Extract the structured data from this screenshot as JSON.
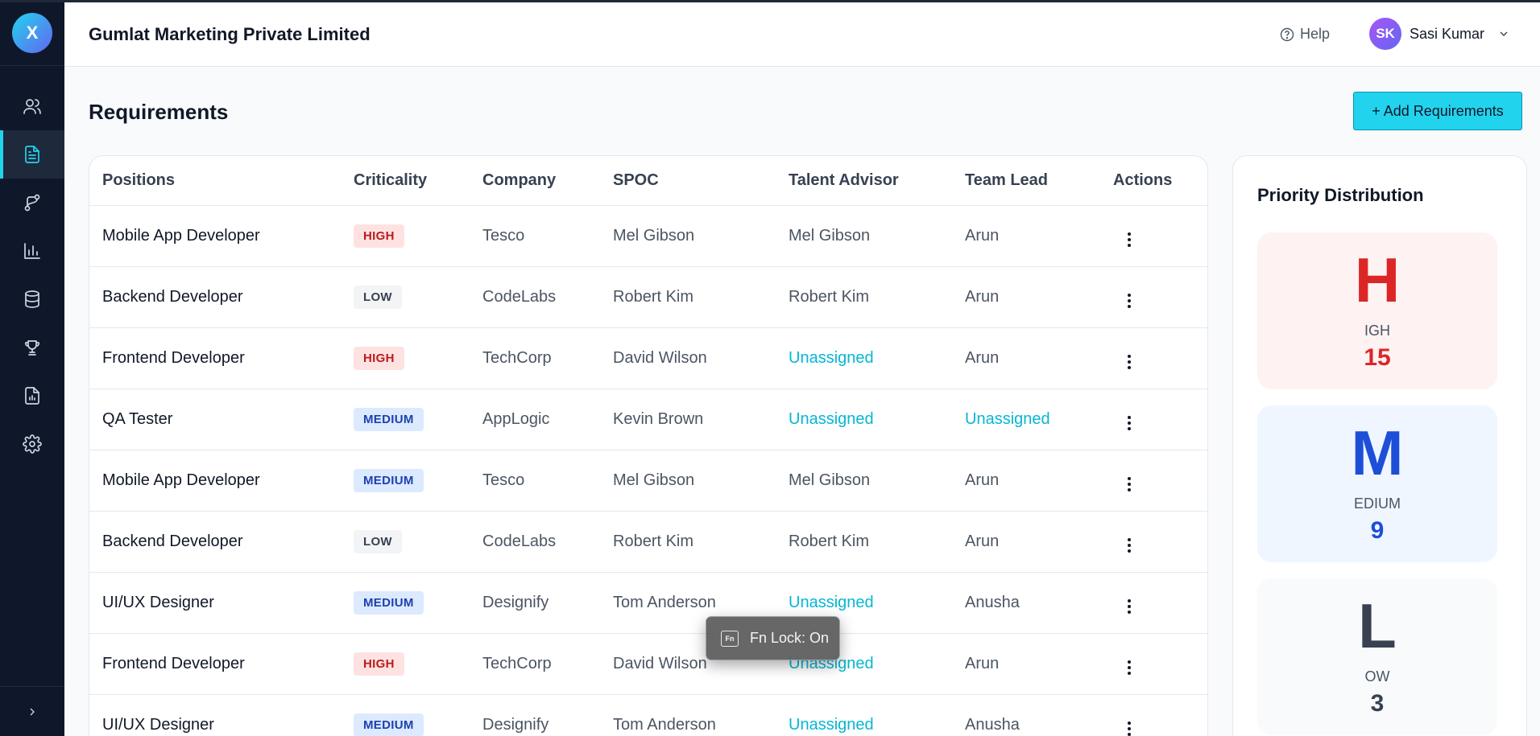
{
  "app": {
    "logo_letter": "X",
    "company_name": "Gumlat Marketing Private Limited"
  },
  "header": {
    "help_label": "Help",
    "user": {
      "initials": "SK",
      "name": "Sasi Kumar"
    }
  },
  "sidebar": {
    "items": [
      {
        "name": "users",
        "icon": "users-icon",
        "active": false
      },
      {
        "name": "requirements",
        "icon": "document-icon",
        "active": true
      },
      {
        "name": "pipeline",
        "icon": "git-branch-icon",
        "active": false
      },
      {
        "name": "analytics",
        "icon": "bar-chart-icon",
        "active": false
      },
      {
        "name": "database",
        "icon": "database-icon",
        "active": false
      },
      {
        "name": "achievements",
        "icon": "trophy-icon",
        "active": false
      },
      {
        "name": "reports",
        "icon": "report-icon",
        "active": false
      },
      {
        "name": "settings",
        "icon": "gear-icon",
        "active": false
      }
    ],
    "expand_icon": "chevron-right-icon"
  },
  "page": {
    "title": "Requirements",
    "add_button_label": "+ Add Requirements"
  },
  "table": {
    "columns": [
      "Positions",
      "Criticality",
      "Company",
      "SPOC",
      "Talent Advisor",
      "Team Lead",
      "Actions"
    ],
    "rows": [
      {
        "position": "Mobile App Developer",
        "criticality": "HIGH",
        "company": "Tesco",
        "spoc": "Mel Gibson",
        "talent_advisor": "Mel Gibson",
        "team_lead": "Arun"
      },
      {
        "position": "Backend Developer",
        "criticality": "LOW",
        "company": "CodeLabs",
        "spoc": "Robert Kim",
        "talent_advisor": "Robert Kim",
        "team_lead": "Arun"
      },
      {
        "position": "Frontend Developer",
        "criticality": "HIGH",
        "company": "TechCorp",
        "spoc": "David Wilson",
        "talent_advisor": "Unassigned",
        "team_lead": "Arun"
      },
      {
        "position": "QA Tester",
        "criticality": "MEDIUM",
        "company": "AppLogic",
        "spoc": "Kevin Brown",
        "talent_advisor": "Unassigned",
        "team_lead": "Unassigned"
      },
      {
        "position": "Mobile App Developer",
        "criticality": "MEDIUM",
        "company": "Tesco",
        "spoc": "Mel Gibson",
        "talent_advisor": "Mel Gibson",
        "team_lead": "Arun"
      },
      {
        "position": "Backend Developer",
        "criticality": "LOW",
        "company": "CodeLabs",
        "spoc": "Robert Kim",
        "talent_advisor": "Robert Kim",
        "team_lead": "Arun"
      },
      {
        "position": "UI/UX Designer",
        "criticality": "MEDIUM",
        "company": "Designify",
        "spoc": "Tom Anderson",
        "talent_advisor": "Unassigned",
        "team_lead": "Anusha"
      },
      {
        "position": "Frontend Developer",
        "criticality": "HIGH",
        "company": "TechCorp",
        "spoc": "David Wilson",
        "talent_advisor": "Unassigned",
        "team_lead": "Arun"
      },
      {
        "position": "UI/UX Designer",
        "criticality": "MEDIUM",
        "company": "Designify",
        "spoc": "Tom Anderson",
        "talent_advisor": "Unassigned",
        "team_lead": "Anusha"
      }
    ]
  },
  "priority": {
    "title": "Priority Distribution",
    "high": {
      "letter": "H",
      "rest": "IGH",
      "count": "15"
    },
    "medium": {
      "letter": "M",
      "rest": "EDIUM",
      "count": "9"
    },
    "low": {
      "letter": "L",
      "rest": "OW",
      "count": "3"
    }
  },
  "toast": {
    "text": "Fn Lock: On",
    "icon_label": "Fn"
  },
  "colors": {
    "accent": "#22d3ee",
    "sidebar_bg": "#0f172a",
    "unassigned": "#06b6d4"
  }
}
